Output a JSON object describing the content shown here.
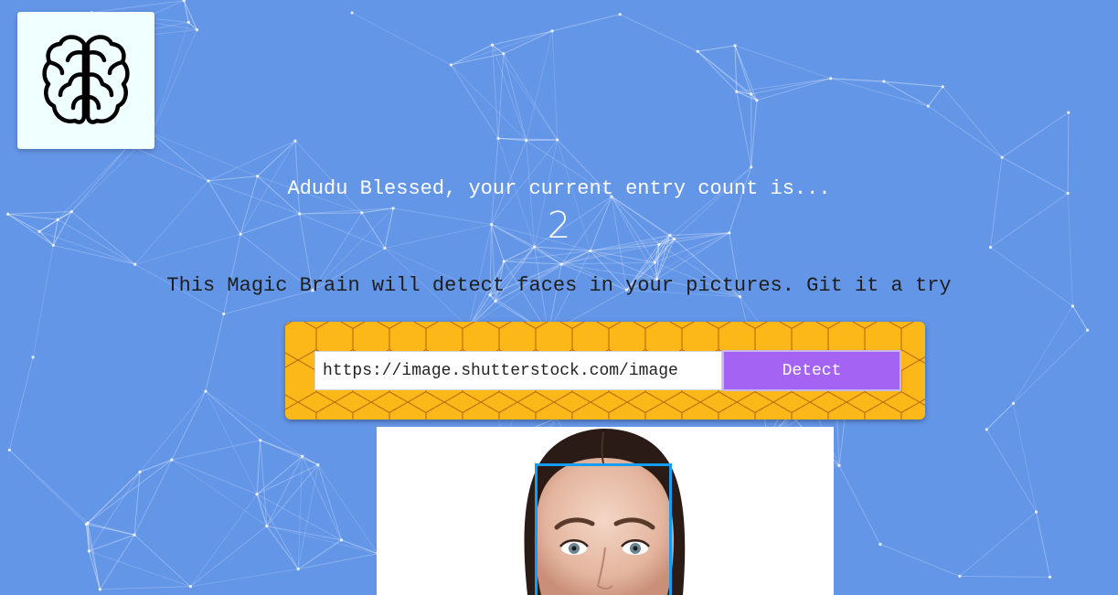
{
  "app": {
    "logo_icon": "brain-icon"
  },
  "rank": {
    "greeting": "Adudu Blessed, your current entry count is...",
    "entry_count": "2"
  },
  "intro": {
    "description": "This Magic Brain will detect faces in your pictures. Git it a try"
  },
  "image_form": {
    "url_value": "https://image.shutterstock.com/image",
    "detect_label": "Detect"
  },
  "result": {
    "image_subject": "woman-face-photo",
    "face_boxes": 1
  },
  "colors": {
    "background": "#6496e8",
    "logo_card": "#f0ffff",
    "form_panel": "#fbb818",
    "detect_button": "#a463f2",
    "face_box": "#149df2"
  }
}
